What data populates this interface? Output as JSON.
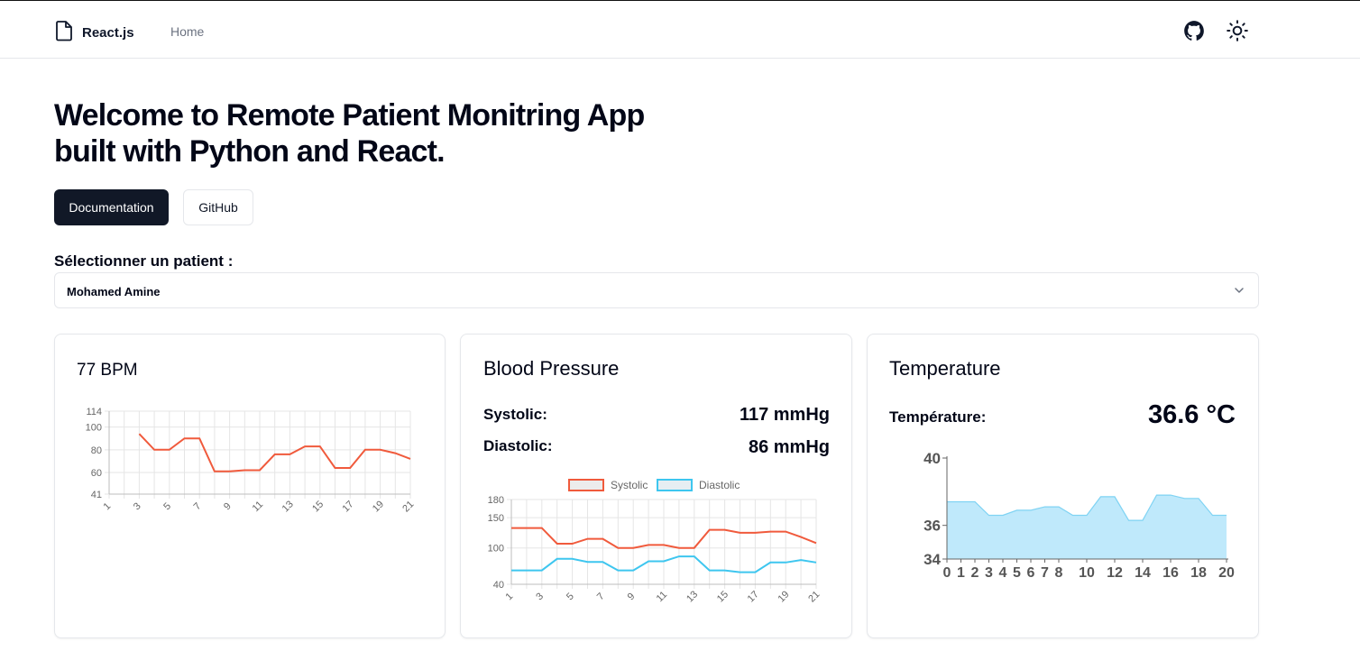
{
  "nav": {
    "brand": "React.js",
    "home": "Home",
    "github_icon": "github-icon",
    "theme_icon": "sun-icon"
  },
  "hero": {
    "title_line1": "Welcome to Remote Patient Monitring App",
    "title_line2": "built with Python and React.",
    "docs_button": "Documentation",
    "github_button": "GitHub"
  },
  "patient_select": {
    "label": "Sélectionner un patient :",
    "selected": "Mohamed Amine"
  },
  "cards": {
    "heart": {
      "title": "77 BPM"
    },
    "bp": {
      "title": "Blood Pressure",
      "systolic_label": "Systolic:",
      "systolic_value": "117 mmHg",
      "diastolic_label": "Diastolic:",
      "diastolic_value": "86 mmHg"
    },
    "temp": {
      "title": "Temperature",
      "label": "Température:",
      "value": "36.6 °C"
    }
  },
  "colors": {
    "accent_dark": "#111827",
    "heart_line": "#f05a3c",
    "systolic": "#f05a3c",
    "diastolic": "#3ec6ef",
    "temp_fill": "#bfe9fb",
    "temp_line": "#7fd3f3"
  },
  "chart_data": [
    {
      "type": "line",
      "x": [
        1,
        2,
        3,
        4,
        5,
        6,
        7,
        8,
        9,
        10,
        11,
        12,
        13,
        14,
        15,
        16,
        17,
        18,
        19,
        20,
        21
      ],
      "x_ticks": [
        "1",
        "3",
        "5",
        "7",
        "9",
        "11",
        "13",
        "15",
        "17",
        "19",
        "21"
      ],
      "series": [
        {
          "values": [
            null,
            null,
            94,
            80,
            80,
            90,
            90,
            61,
            61,
            62,
            62,
            76,
            76,
            83,
            83,
            64,
            64,
            80,
            80,
            77,
            72
          ]
        }
      ],
      "y_ticks": [
        41,
        60,
        80,
        100,
        114
      ],
      "ylim": [
        41,
        114
      ],
      "grid": true
    },
    {
      "type": "line",
      "x": [
        1,
        2,
        3,
        4,
        5,
        6,
        7,
        8,
        9,
        10,
        11,
        12,
        13,
        14,
        15,
        16,
        17,
        18,
        19,
        20,
        21
      ],
      "x_ticks": [
        "1",
        "3",
        "5",
        "7",
        "9",
        "11",
        "13",
        "15",
        "17",
        "19",
        "21"
      ],
      "series": [
        {
          "name": "Systolic",
          "values": [
            133,
            133,
            133,
            107,
            107,
            115,
            115,
            100,
            100,
            105,
            105,
            100,
            100,
            130,
            130,
            125,
            125,
            127,
            127,
            118,
            108
          ]
        },
        {
          "name": "Diastolic",
          "values": [
            63,
            63,
            63,
            82,
            82,
            77,
            77,
            63,
            63,
            78,
            78,
            86,
            86,
            63,
            63,
            60,
            60,
            76,
            76,
            80,
            76
          ]
        }
      ],
      "y_ticks": [
        40,
        100,
        150,
        180
      ],
      "ylim": [
        40,
        180
      ],
      "legend": "top",
      "grid": true
    },
    {
      "type": "area",
      "x": [
        0,
        1,
        2,
        3,
        4,
        5,
        6,
        7,
        8,
        9,
        10,
        11,
        12,
        13,
        14,
        15,
        16,
        17,
        18,
        19,
        20
      ],
      "x_ticks": [
        "0",
        "1",
        "2",
        "3",
        "4",
        "5",
        "6",
        "7",
        "8",
        "10",
        "12",
        "14",
        "16",
        "18",
        "20"
      ],
      "series": [
        {
          "values": [
            37.4,
            37.4,
            37.4,
            36.6,
            36.6,
            36.9,
            36.9,
            37.1,
            37.1,
            36.6,
            36.6,
            37.7,
            37.7,
            36.3,
            36.3,
            37.8,
            37.8,
            37.6,
            37.6,
            36.6,
            36.6
          ]
        }
      ],
      "y_ticks": [
        34,
        36,
        40
      ],
      "ylim": [
        34,
        40
      ],
      "grid": false
    }
  ]
}
